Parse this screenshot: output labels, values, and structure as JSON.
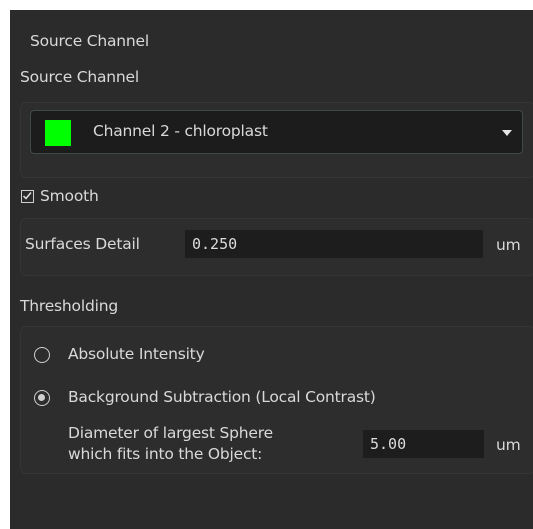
{
  "panel": {
    "title": "Source Channel"
  },
  "source_channel": {
    "label": "Source Channel",
    "selected": "Channel 2 - chloroplast",
    "selected_color": "#00ff00"
  },
  "smooth": {
    "label": "Smooth",
    "checked": true,
    "detail_label": "Surfaces Detail",
    "detail_value": "0.250",
    "detail_unit": "um"
  },
  "thresholding": {
    "label": "Thresholding",
    "options": [
      {
        "label": "Absolute Intensity",
        "selected": false
      },
      {
        "label": "Background Subtraction (Local Contrast)",
        "selected": true
      }
    ],
    "diameter_label_line1": "Diameter of largest Sphere",
    "diameter_label_line2": "which fits into the Object:",
    "diameter_value": "5.00",
    "diameter_unit": "um"
  }
}
